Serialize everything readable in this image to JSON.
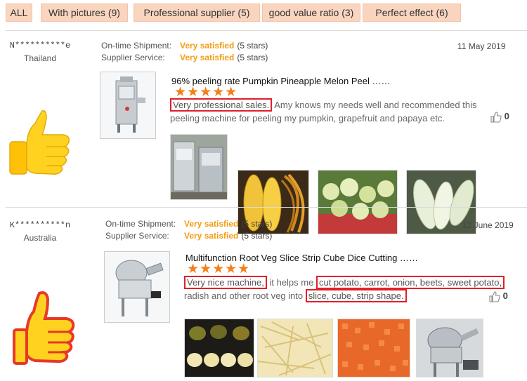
{
  "filters": [
    {
      "label": "ALL"
    },
    {
      "label": "With pictures (9)"
    },
    {
      "label": "Professional supplier (5)"
    },
    {
      "label": "good value ratio (3)"
    },
    {
      "label": "Perfect effect (6)"
    }
  ],
  "reviews": [
    {
      "buyer_name": "N**********e",
      "country": "Thailand",
      "shipment_label": "On-time Shipment:",
      "shipment_value": "Very satisfied",
      "shipment_stars": "(5 stars)",
      "service_label": "Supplier Service:",
      "service_value": "Very satisfied",
      "service_stars": "(5 stars)",
      "date": "11 May 2019",
      "product_title": "96% peeling rate Pumpkin  Pineapple  Melon Peel ……",
      "rating_stars": "★★★★★",
      "comment_hl1": "Very professional sales.",
      "comment_rest1": " Amy knows my needs well and recommended  this",
      "comment_line2": "peeling machine for peeling my pumpkin, grapefruit and papaya etc.",
      "likes": "0",
      "photos": [
        "peeler-machines-photo",
        "peeled-squash-photo",
        "peeled-melons-photo",
        "peeled-gourds-photo"
      ]
    },
    {
      "buyer_name": "K**********n",
      "country": "Australia",
      "shipment_label": "On-time Shipment:",
      "shipment_value": "Very satisfied",
      "shipment_stars": "(5 stars)",
      "service_label": "Supplier  Service:",
      "service_value": "Very satisfied",
      "service_stars": "(5 stars)",
      "date": "12 June 2019",
      "product_title": "Multifunction Root Veg Slice Strip Cube Dice Cutting ……",
      "rating_stars": "★★★★★",
      "comment_hl1": "Very nice machine,",
      "comment_mid1": " it helps me ",
      "comment_hl2": "cut potato, carrot, onion, beets, sweet potato,",
      "comment_pre2": "radish and other root veg into ",
      "comment_hl3": "slice, cube, strip shape.",
      "likes": "0",
      "photos": [
        "sliced-potato-photo",
        "potato-strips-photo",
        "diced-carrot-photo",
        "cutter-machine-photo"
      ]
    }
  ],
  "colors": {
    "chip_bg": "#f9d5bf",
    "accent_orange": "#f39c12",
    "star_orange": "#f47f1a",
    "highlight_red": "#e0202a",
    "thumb_yellow": "#ffd21f",
    "thumb_red": "#e8382a"
  }
}
